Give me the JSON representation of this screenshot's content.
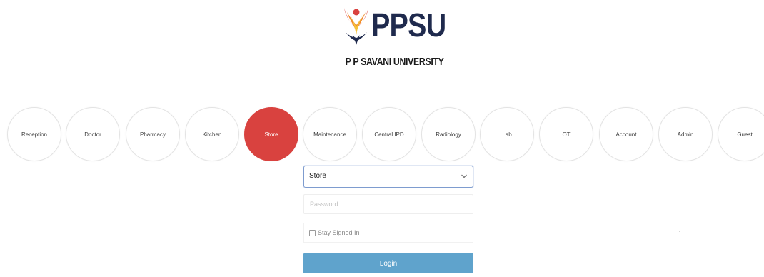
{
  "brand": {
    "wordmark": "PPSU",
    "subtitle": "P P SAVANI UNIVERSITY",
    "emblem_icon": "ppsu-flame-emblem",
    "colors": {
      "navy": "#1f2a4d",
      "red": "#d9423f",
      "orange": "#f08a2c",
      "yellow": "#f5c23a"
    }
  },
  "roles": {
    "items": [
      {
        "label": "Reception",
        "active": false
      },
      {
        "label": "Doctor",
        "active": false
      },
      {
        "label": "Pharmacy",
        "active": false
      },
      {
        "label": "Kitchen",
        "active": false
      },
      {
        "label": "Store",
        "active": true
      },
      {
        "label": "Maintenance",
        "active": false
      },
      {
        "label": "Central IPD",
        "active": false
      },
      {
        "label": "Radiology",
        "active": false
      },
      {
        "label": "Lab",
        "active": false
      },
      {
        "label": "OT",
        "active": false
      },
      {
        "label": "Account",
        "active": false
      },
      {
        "label": "Admin",
        "active": false
      },
      {
        "label": "Guest",
        "active": false
      }
    ],
    "active_color": "#d9423f"
  },
  "login": {
    "department_select": {
      "selected_value": "Store",
      "icon": "chevron-down-icon"
    },
    "password": {
      "placeholder": "Password",
      "value": ""
    },
    "remember": {
      "label": "Stay Signed In",
      "checked": false
    },
    "submit_label": "Login",
    "button_color": "#5fa3cc"
  }
}
